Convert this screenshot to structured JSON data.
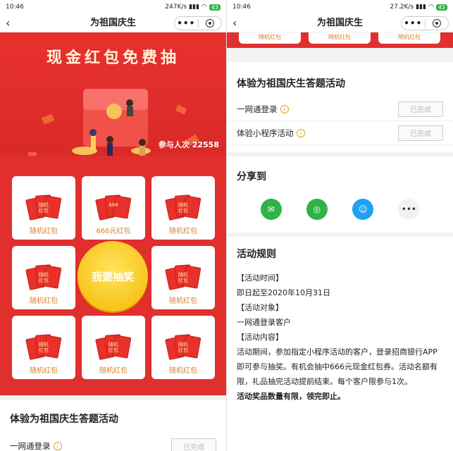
{
  "left": {
    "status": {
      "time": "10:46",
      "speed": "247K/s",
      "battery": "43"
    },
    "nav": {
      "title": "为祖国庆生",
      "more": "•••"
    },
    "banner": {
      "title": "现金红包免费抽",
      "participants_label": "参与人次 22558"
    },
    "prizes": [
      {
        "label": "随机红包",
        "env_text": "随机\n红包"
      },
      {
        "label": "666元红包",
        "env_text": "666"
      },
      {
        "label": "随机红包",
        "env_text": "随机\n红包"
      },
      {
        "label": "随机红包",
        "env_text": "随机\n红包"
      },
      {
        "label": "随机红包",
        "env_text": "随机\n红包"
      },
      {
        "label": "随机红包",
        "env_text": "随机\n红包"
      },
      {
        "label": "随机红包",
        "env_text": "随机\n红包"
      },
      {
        "label": "随机红包",
        "env_text": "随机\n红包"
      }
    ],
    "spin_label": "我要抽奖",
    "activity_title": "体验为祖国庆生答题活动",
    "first_task": "一网通登录",
    "first_task_status": "已完成"
  },
  "right": {
    "status": {
      "time": "10:46",
      "speed": "27.2K/s",
      "battery": "43"
    },
    "nav": {
      "title": "为祖国庆生",
      "more": "•••"
    },
    "tab_text": "随机红包",
    "activity_title": "体验为祖国庆生答题活动",
    "tasks": [
      {
        "name": "一网通登录",
        "status": "已完成"
      },
      {
        "name": "体验小程序活动",
        "status": "已完成"
      }
    ],
    "share_title": "分享到",
    "share_more": "•••",
    "rules_title": "活动规则",
    "rules": {
      "time_label": "【活动时间】",
      "time": "即日起至2020年10月31日",
      "target_label": "【活动对象】",
      "target": "一网通登录客户",
      "content_label": "【活动内容】",
      "content": "活动期间，参加指定小程序活动的客户，登录招商银行APP即可参与抽奖。有机会抽中666元现金红包券。活动名额有限，礼品抽完活动提前结束。每个客户限参与1次。",
      "note": "活动奖品数量有限，领完即止。"
    }
  },
  "colors": {
    "primary_red": "#e02f2d",
    "gold": "#f5b800",
    "wechat": "#2fb344",
    "qq": "#1da1f2"
  }
}
